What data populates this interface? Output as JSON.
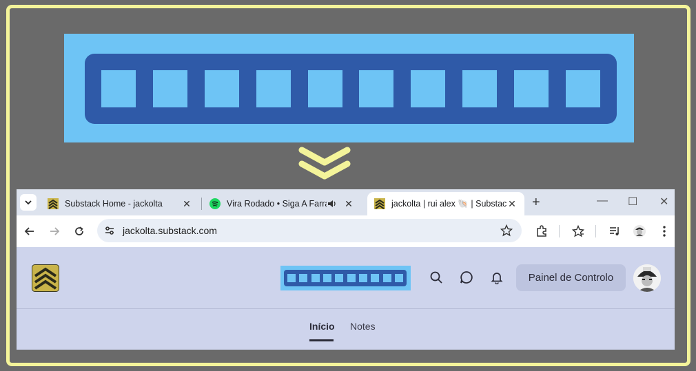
{
  "browser": {
    "tabs": [
      {
        "title": "Substack Home - jackolta",
        "favicon": "chevron-logo-icon",
        "active": false
      },
      {
        "title": "Vira Rodado • Siga A Farra",
        "favicon": "spotify-icon",
        "active": false,
        "audio": true
      },
      {
        "title": "jackolta | rui alex 🐚 | Substack",
        "favicon": "chevron-logo-icon",
        "active": true
      }
    ],
    "url": "jackolta.substack.com"
  },
  "site": {
    "dashboard_button": "Painel de Controlo",
    "nav_tabs": [
      {
        "label": "Início",
        "active": true
      },
      {
        "label": "Notes",
        "active": false
      }
    ]
  },
  "colors": {
    "frame": "#f4f49a",
    "banner_bg": "#6ec4f5",
    "logo_bar": "#2f5aa8",
    "site_bg": "#ced4ec",
    "logo_gold": "#c9b44a"
  }
}
